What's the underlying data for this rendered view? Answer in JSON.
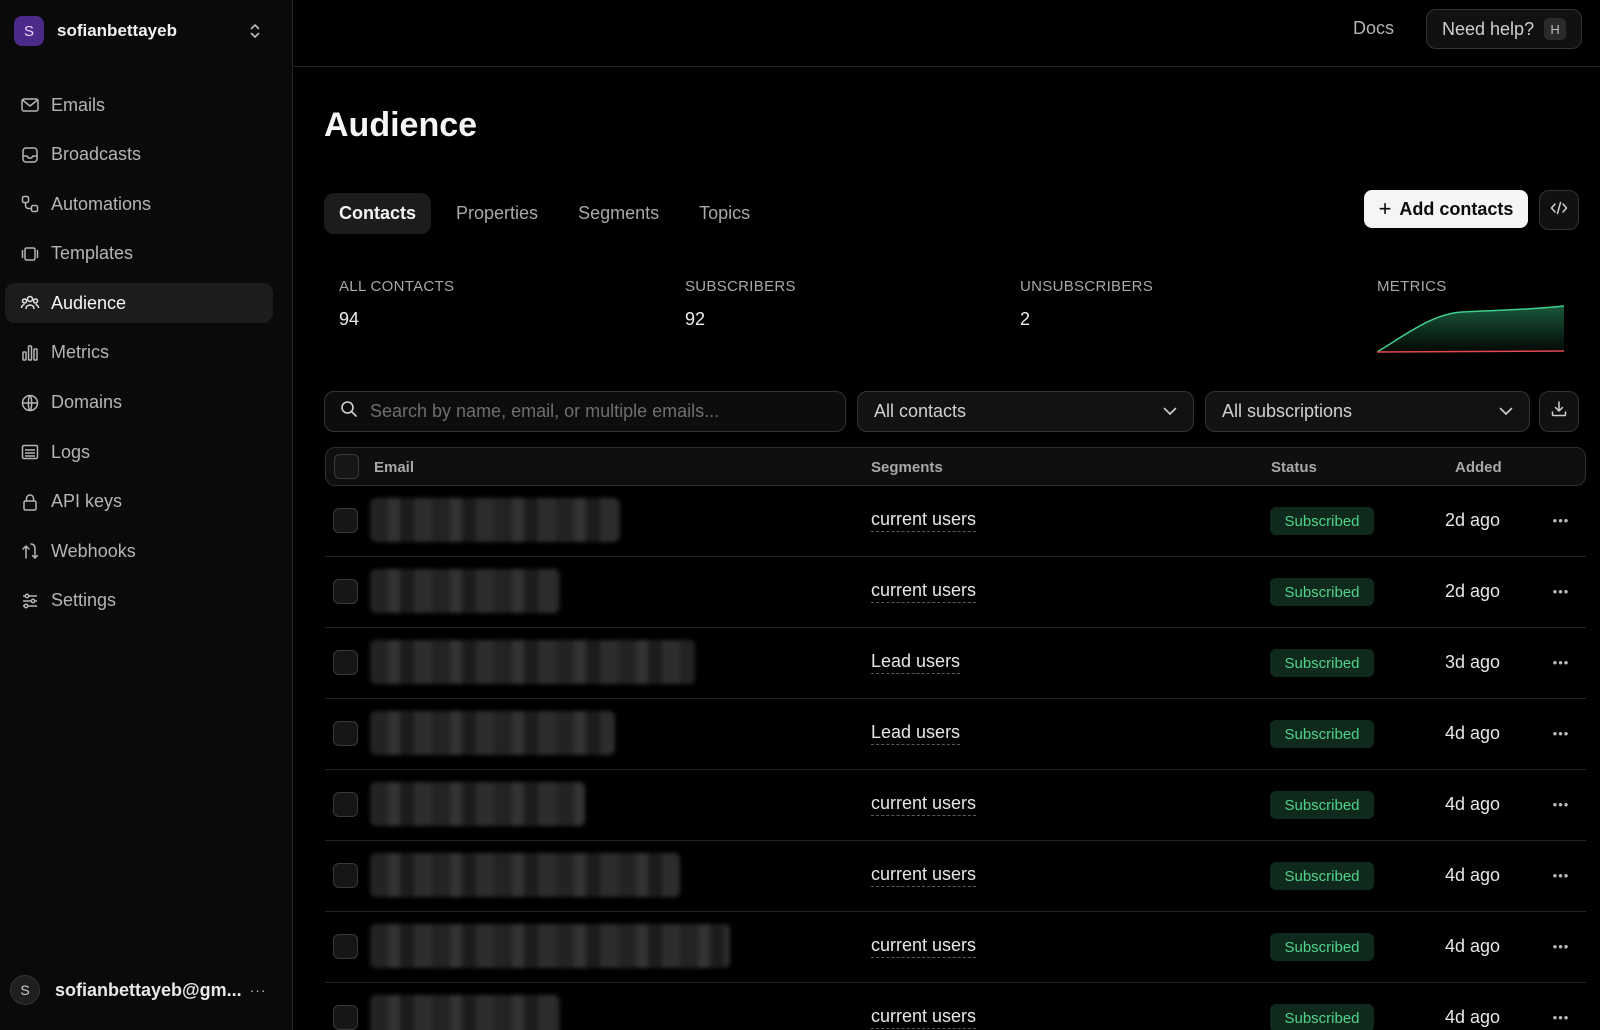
{
  "workspace": {
    "initial": "S",
    "name": "sofianbettayeb"
  },
  "sidebar": {
    "items": [
      {
        "label": "Emails",
        "icon": "mail-icon"
      },
      {
        "label": "Broadcasts",
        "icon": "inbox-icon"
      },
      {
        "label": "Automations",
        "icon": "workflow-icon"
      },
      {
        "label": "Templates",
        "icon": "template-icon"
      },
      {
        "label": "Audience",
        "icon": "users-icon",
        "active": true
      },
      {
        "label": "Metrics",
        "icon": "bar-chart-icon"
      },
      {
        "label": "Domains",
        "icon": "globe-icon"
      },
      {
        "label": "Logs",
        "icon": "list-icon"
      },
      {
        "label": "API keys",
        "icon": "lock-icon"
      },
      {
        "label": "Webhooks",
        "icon": "webhook-icon"
      },
      {
        "label": "Settings",
        "icon": "sliders-icon"
      }
    ]
  },
  "user": {
    "initial": "S",
    "email": "sofianbettayeb@gm...",
    "more": "···"
  },
  "topbar": {
    "docs": "Docs",
    "help": "Need help?",
    "help_key": "H"
  },
  "page": {
    "title": "Audience"
  },
  "tabs": [
    "Contacts",
    "Properties",
    "Segments",
    "Topics"
  ],
  "actions": {
    "add_contacts": "Add contacts"
  },
  "stats": {
    "all_contacts": {
      "label": "ALL CONTACTS",
      "value": "94"
    },
    "subscribers": {
      "label": "SUBSCRIBERS",
      "value": "92"
    },
    "unsubscribers": {
      "label": "UNSUBSCRIBERS",
      "value": "2"
    },
    "metrics": {
      "label": "METRICS"
    }
  },
  "filters": {
    "search_placeholder": "Search by name, email, or multiple emails...",
    "contacts_filter": "All contacts",
    "subscriptions_filter": "All subscriptions"
  },
  "table": {
    "columns": {
      "email": "Email",
      "segments": "Segments",
      "status": "Status",
      "added": "Added"
    },
    "rows": [
      {
        "segment": "current users",
        "status": "Subscribed",
        "added": "2d ago"
      },
      {
        "segment": "current users",
        "status": "Subscribed",
        "added": "2d ago"
      },
      {
        "segment": "Lead users",
        "status": "Subscribed",
        "added": "3d ago"
      },
      {
        "segment": "Lead users",
        "status": "Subscribed",
        "added": "4d ago"
      },
      {
        "segment": "current users",
        "status": "Subscribed",
        "added": "4d ago"
      },
      {
        "segment": "current users",
        "status": "Subscribed",
        "added": "4d ago"
      },
      {
        "segment": "current users",
        "status": "Subscribed",
        "added": "4d ago"
      },
      {
        "segment": "current users",
        "status": "Subscribed",
        "added": "4d ago"
      }
    ]
  },
  "colors": {
    "accent_green": "#4fd38a",
    "badge_bg": "#0f2a1c",
    "background": "#000000",
    "sparkline_subscribed": "#3ecf8e",
    "sparkline_unsubscribed": "#e5484d"
  }
}
